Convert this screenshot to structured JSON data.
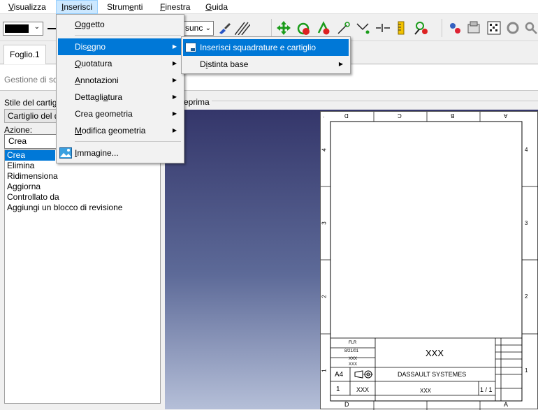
{
  "menubar": {
    "items": [
      {
        "label": "Visualizza",
        "u": "V",
        "rest": "isualizza"
      },
      {
        "label": "Inserisci",
        "u": "I",
        "rest": "nserisci"
      },
      {
        "label": "Strumenti",
        "pre": "Strum",
        "u": "e",
        "rest": "nti"
      },
      {
        "label": "Finestra",
        "u": "F",
        "rest": "inestra"
      },
      {
        "label": "Guida",
        "u": "G",
        "rest": "uida"
      }
    ]
  },
  "toolbar": {
    "line_style_value": "sunc",
    "icons": [
      "color-swatch-icon",
      "line-weight-icon",
      "line-style-dropdown",
      "paint-brush-icon",
      "hatch-pattern-icon",
      "move-arrows-icon",
      "rotate-icon",
      "scale-icon",
      "snap-icon",
      "dimension-icon",
      "explode-icon",
      "ruler-icon",
      "no-show-icon",
      "settings-icon",
      "properties-icon",
      "grid-icon",
      "tools-icon",
      "search-icon"
    ]
  },
  "tabs": [
    {
      "label": "Foglio.1"
    }
  ],
  "panel_header": {
    "title": "Gestione di sq"
  },
  "left_panel": {
    "style_label": "Stile del cartig",
    "style_value": "Cartiglio del d",
    "action_label": "Azione:",
    "action_value": "Crea",
    "actions": [
      "Crea",
      "Elimina",
      "Ridimensiona",
      "Aggiorna",
      "Controllato da",
      "Aggiungi un blocco di revisione"
    ]
  },
  "preview": {
    "title_fragment": "eprima"
  },
  "drawing": {
    "col_labels": [
      "D",
      "C",
      "B",
      "A"
    ],
    "row_labels": [
      "4",
      "3",
      "2",
      "1"
    ],
    "title_value": "XXX",
    "company": "DASSAULT SYSTEMES",
    "size": "A4",
    "scale": "1",
    "sheet": "1 / 1",
    "doc_number": "XXX",
    "drawn_by": "FLR",
    "date": "8/21/01",
    "checked": "XXX",
    "approved": "XXX",
    "part_number": "XXX",
    "weight": "XXX"
  },
  "insert_menu": {
    "items": [
      {
        "label": "Oggetto",
        "u": "O",
        "rest": "ggetto",
        "submenu": false
      },
      {
        "label": "Disegno",
        "pre": "Dis",
        "u": "e",
        "rest": "gno",
        "submenu": true,
        "highlighted": true
      },
      {
        "label": "Quotatura",
        "u": "Q",
        "rest": "uotatura",
        "submenu": true
      },
      {
        "label": "Annotazioni",
        "u": "A",
        "rest": "nnotazioni",
        "submenu": true
      },
      {
        "label": "Dettagliatura",
        "pre": "Dettagli",
        "u": "a",
        "rest": "tura",
        "submenu": true
      },
      {
        "label": "Crea geometria",
        "pre": "Crea ",
        "u": "g",
        "rest": "eometria",
        "submenu": true
      },
      {
        "label": "Modifica geometria",
        "u": "M",
        "rest": "odifica geometria",
        "submenu": true
      },
      {
        "label": "Immagine...",
        "u": "I",
        "rest": "mmagine...",
        "submenu": false
      }
    ]
  },
  "disegno_submenu": {
    "items": [
      {
        "label": "Inserisci squadrature e cartiglio",
        "highlighted": true,
        "submenu": false
      },
      {
        "label": "Distinta base",
        "pre": "D",
        "u": "i",
        "rest": "stinta base",
        "submenu": true
      }
    ]
  }
}
